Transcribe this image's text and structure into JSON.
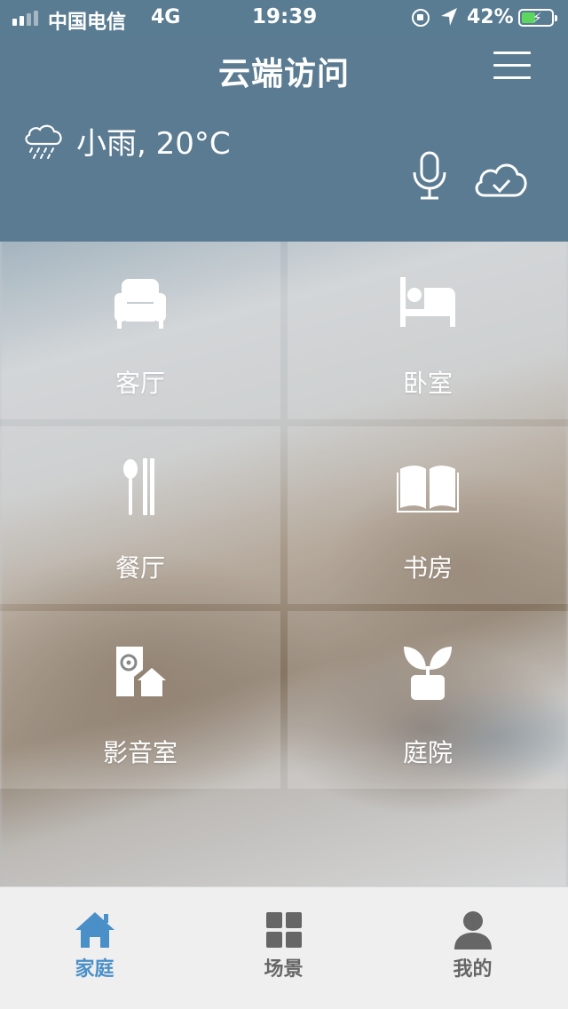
{
  "status_bar": {
    "carrier": "中国电信",
    "network": "4G",
    "time": "19:39",
    "battery_percent": "42%",
    "battery_level": 0.42,
    "battery_color": "#5cd65c"
  },
  "header": {
    "title": "云端访问",
    "weather": "小雨, 20°C",
    "weather_icon": "rain-cloud-icon",
    "menu_icon": "hamburger-icon",
    "mic_icon": "microphone-icon",
    "cloud_icon": "cloud-check-icon",
    "background_color": "#5a7b91"
  },
  "rooms": [
    {
      "label": "客厅",
      "icon": "sofa-icon"
    },
    {
      "label": "卧室",
      "icon": "bed-icon"
    },
    {
      "label": "餐厅",
      "icon": "utensils-icon"
    },
    {
      "label": "书房",
      "icon": "book-icon"
    },
    {
      "label": "影音室",
      "icon": "speaker-icon"
    },
    {
      "label": "庭院",
      "icon": "plant-icon"
    }
  ],
  "tab_bar": {
    "active_color": "#4a8fc8",
    "inactive_color": "#666666",
    "tabs": [
      {
        "label": "家庭",
        "icon": "home-icon",
        "active": true
      },
      {
        "label": "场景",
        "icon": "grid-icon",
        "active": false
      },
      {
        "label": "我的",
        "icon": "user-icon",
        "active": false
      }
    ]
  }
}
